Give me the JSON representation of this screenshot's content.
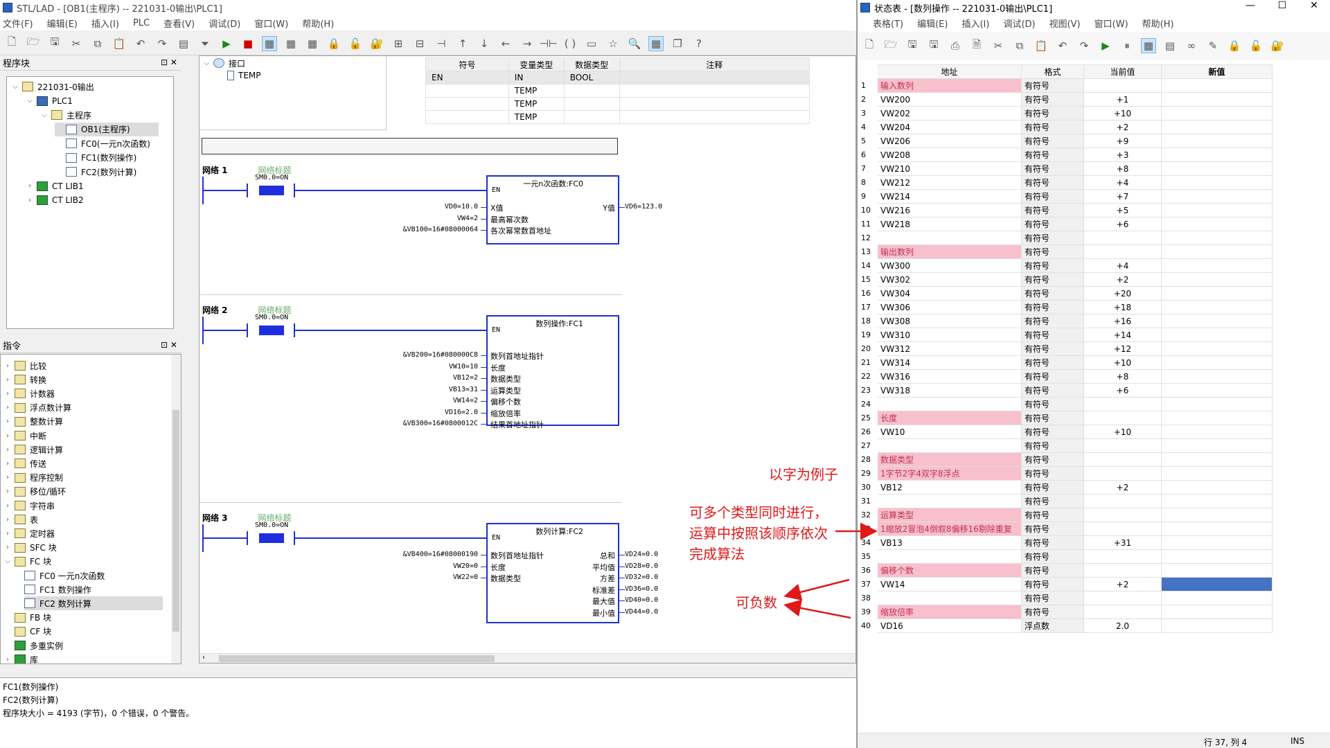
{
  "app": {
    "title": "STL/LAD - [OB1(主程序) -- 221031-0输出\\PLC1]",
    "menus": [
      "文件(F)",
      "编辑(E)",
      "插入(I)",
      "PLC",
      "查看(V)",
      "调试(D)",
      "窗口(W)",
      "帮助(H)"
    ]
  },
  "program_panel": {
    "title": "程序块",
    "items": [
      {
        "label": "221031-0输出",
        "toggle": "⌵",
        "icon": "cat"
      },
      {
        "label": "PLC1",
        "toggle": "⌵",
        "icon": "plc"
      },
      {
        "label": "主程序",
        "toggle": "⌵",
        "icon": "cat"
      },
      {
        "label": "OB1(主程序)",
        "toggle": "",
        "icon": "doc",
        "selected": true
      },
      {
        "label": "FC0(一元n次函数)",
        "toggle": "",
        "icon": "doc"
      },
      {
        "label": "FC1(数列操作)",
        "toggle": "",
        "icon": "doc"
      },
      {
        "label": "FC2(数列计算)",
        "toggle": "",
        "icon": "doc"
      },
      {
        "label": "CT LIB1",
        "toggle": "›",
        "icon": "lib"
      },
      {
        "label": "CT LIB2",
        "toggle": "›",
        "icon": "lib"
      }
    ]
  },
  "instr_panel": {
    "title": "指令",
    "items": [
      {
        "label": "比较",
        "toggle": "›"
      },
      {
        "label": "转换",
        "toggle": "›"
      },
      {
        "label": "计数器",
        "toggle": "›"
      },
      {
        "label": "浮点数计算",
        "toggle": "›"
      },
      {
        "label": "整数计算",
        "toggle": "›"
      },
      {
        "label": "中断",
        "toggle": "›"
      },
      {
        "label": "逻辑计算",
        "toggle": "›"
      },
      {
        "label": "传送",
        "toggle": "›"
      },
      {
        "label": "程序控制",
        "toggle": "›"
      },
      {
        "label": "移位/循环",
        "toggle": "›"
      },
      {
        "label": "字符串",
        "toggle": "›"
      },
      {
        "label": "表",
        "toggle": "›"
      },
      {
        "label": "定时器",
        "toggle": "›"
      },
      {
        "label": "SFC 块",
        "toggle": "›"
      },
      {
        "label": "FC 块",
        "toggle": "⌵"
      },
      {
        "label": "FC0    一元n次函数",
        "toggle": "",
        "icon": "doc",
        "indent": 2
      },
      {
        "label": "FC1    数列操作",
        "toggle": "",
        "icon": "doc",
        "indent": 2
      },
      {
        "label": "FC2    数列计算",
        "toggle": "",
        "icon": "doc",
        "indent": 2,
        "selected": true
      },
      {
        "label": "FB 块",
        "toggle": ""
      },
      {
        "label": "CF 块",
        "toggle": ""
      },
      {
        "label": "多重实例",
        "toggle": "",
        "icon": "lib"
      },
      {
        "label": "库",
        "toggle": "›",
        "icon": "lib"
      }
    ]
  },
  "interface": {
    "root": "接口",
    "child": "TEMP",
    "headers": [
      "符号",
      "变量类型",
      "数据类型",
      "注释"
    ],
    "rows": [
      [
        "EN",
        "IN",
        "BOOL",
        ""
      ],
      [
        "",
        "TEMP",
        "",
        ""
      ],
      [
        "",
        "TEMP",
        "",
        ""
      ],
      [
        "",
        "TEMP",
        "",
        ""
      ]
    ]
  },
  "networks": [
    {
      "label": "网络 1",
      "comment": "网络标题",
      "contact": "SM0.0=ON",
      "block": "一元n次函数:FC0",
      "en": "EN",
      "inputs": [
        {
          "value": "VD0=10.0",
          "name": "X值"
        },
        {
          "value": "VW4=2",
          "name": "最高幂次数"
        },
        {
          "value": "&VB100=16#08000064",
          "name": "各次幂常数首地址"
        }
      ],
      "outputs": [
        {
          "name": "Y值",
          "value": "VD6=123.0"
        }
      ]
    },
    {
      "label": "网络 2",
      "comment": "网络标题",
      "contact": "SM0.0=ON",
      "block": "数列操作:FC1",
      "en": "EN",
      "inputs": [
        {
          "value": "&VB200=16#080000C8",
          "name": "数列首地址指针"
        },
        {
          "value": "VW10=10",
          "name": "长度"
        },
        {
          "value": "VB12=2",
          "name": "数据类型"
        },
        {
          "value": "VB13=31",
          "name": "运算类型"
        },
        {
          "value": "VW14=2",
          "name": "偏移个数"
        },
        {
          "value": "VD16=2.0",
          "name": "缩放倍率"
        },
        {
          "value": "&VB300=16#0800012C",
          "name": "结果首地址指针"
        }
      ],
      "outputs": []
    },
    {
      "label": "网络 3",
      "comment": "网络标题",
      "contact": "SM0.0=ON",
      "block": "数列计算:FC2",
      "en": "EN",
      "inputs": [
        {
          "value": "&VB400=16#08000190",
          "name": "数列首地址指针"
        },
        {
          "value": "VW20=0",
          "name": "长度"
        },
        {
          "value": "VW22=0",
          "name": "数据类型"
        }
      ],
      "outputs": [
        {
          "name": "总和",
          "value": "VD24=0.0"
        },
        {
          "name": "平均值",
          "value": "VD28=0.0"
        },
        {
          "name": "方差",
          "value": "VD32=0.0"
        },
        {
          "name": "标准差",
          "value": "VD36=0.0"
        },
        {
          "name": "最大值",
          "value": "VD40=0.0"
        },
        {
          "name": "最小值",
          "value": "VD44=0.0"
        }
      ]
    }
  ],
  "output_lines": [
    "FC1(数列操作)",
    "FC2(数列计算)",
    "程序块大小 = 4193 (字节)，0 个错误，0 个警告。"
  ],
  "status_window": {
    "title": "状态表 - [数列操作 -- 221031-0输出\\PLC1]",
    "menus": [
      "表格(T)",
      "编辑(E)",
      "插入(I)",
      "调试(D)",
      "视图(V)",
      "窗口(W)",
      "帮助(H)"
    ],
    "headers": [
      "地址",
      "格式",
      "当前值",
      "新值"
    ],
    "rows": [
      {
        "n": "1",
        "addr": "输入数列",
        "fmt": "有符号",
        "cur": "",
        "pink": true
      },
      {
        "n": "2",
        "addr": "VW200",
        "fmt": "有符号",
        "cur": "+1"
      },
      {
        "n": "3",
        "addr": "VW202",
        "fmt": "有符号",
        "cur": "+10"
      },
      {
        "n": "4",
        "addr": "VW204",
        "fmt": "有符号",
        "cur": "+2"
      },
      {
        "n": "5",
        "addr": "VW206",
        "fmt": "有符号",
        "cur": "+9"
      },
      {
        "n": "6",
        "addr": "VW208",
        "fmt": "有符号",
        "cur": "+3"
      },
      {
        "n": "7",
        "addr": "VW210",
        "fmt": "有符号",
        "cur": "+8"
      },
      {
        "n": "8",
        "addr": "VW212",
        "fmt": "有符号",
        "cur": "+4"
      },
      {
        "n": "9",
        "addr": "VW214",
        "fmt": "有符号",
        "cur": "+7"
      },
      {
        "n": "10",
        "addr": "VW216",
        "fmt": "有符号",
        "cur": "+5"
      },
      {
        "n": "11",
        "addr": "VW218",
        "fmt": "有符号",
        "cur": "+6"
      },
      {
        "n": "12",
        "addr": "",
        "fmt": "有符号",
        "cur": ""
      },
      {
        "n": "13",
        "addr": "输出数列",
        "fmt": "有符号",
        "cur": "",
        "pink": true
      },
      {
        "n": "14",
        "addr": "VW300",
        "fmt": "有符号",
        "cur": "+4"
      },
      {
        "n": "15",
        "addr": "VW302",
        "fmt": "有符号",
        "cur": "+2"
      },
      {
        "n": "16",
        "addr": "VW304",
        "fmt": "有符号",
        "cur": "+20"
      },
      {
        "n": "17",
        "addr": "VW306",
        "fmt": "有符号",
        "cur": "+18"
      },
      {
        "n": "18",
        "addr": "VW308",
        "fmt": "有符号",
        "cur": "+16"
      },
      {
        "n": "19",
        "addr": "VW310",
        "fmt": "有符号",
        "cur": "+14"
      },
      {
        "n": "20",
        "addr": "VW312",
        "fmt": "有符号",
        "cur": "+12"
      },
      {
        "n": "21",
        "addr": "VW314",
        "fmt": "有符号",
        "cur": "+10"
      },
      {
        "n": "22",
        "addr": "VW316",
        "fmt": "有符号",
        "cur": "+8"
      },
      {
        "n": "23",
        "addr": "VW318",
        "fmt": "有符号",
        "cur": "+6"
      },
      {
        "n": "24",
        "addr": "",
        "fmt": "有符号",
        "cur": ""
      },
      {
        "n": "25",
        "addr": "长度",
        "fmt": "有符号",
        "cur": "",
        "pink": true
      },
      {
        "n": "26",
        "addr": "VW10",
        "fmt": "有符号",
        "cur": "+10"
      },
      {
        "n": "27",
        "addr": "",
        "fmt": "有符号",
        "cur": ""
      },
      {
        "n": "28",
        "addr": "数据类型",
        "fmt": "有符号",
        "cur": "",
        "pink": true
      },
      {
        "n": "29",
        "addr": "1字节2字4双字8浮点",
        "fmt": "有符号",
        "cur": "",
        "pink": true
      },
      {
        "n": "30",
        "addr": "VB12",
        "fmt": "有符号",
        "cur": "+2"
      },
      {
        "n": "31",
        "addr": "",
        "fmt": "有符号",
        "cur": ""
      },
      {
        "n": "32",
        "addr": "运算类型",
        "fmt": "有符号",
        "cur": "",
        "pink": true
      },
      {
        "n": "33",
        "addr": "1缩放2冒泡4倒叙8偏移16剔除重复",
        "fmt": "有符号",
        "cur": "",
        "pink": true
      },
      {
        "n": "34",
        "addr": "VB13",
        "fmt": "有符号",
        "cur": "+31"
      },
      {
        "n": "35",
        "addr": "",
        "fmt": "有符号",
        "cur": ""
      },
      {
        "n": "36",
        "addr": "偏移个数",
        "fmt": "有符号",
        "cur": "",
        "pink": true
      },
      {
        "n": "37",
        "addr": "VW14",
        "fmt": "有符号",
        "cur": "+2",
        "newsel": true
      },
      {
        "n": "38",
        "addr": "",
        "fmt": "有符号",
        "cur": ""
      },
      {
        "n": "39",
        "addr": "缩放倍率",
        "fmt": "有符号",
        "cur": "",
        "pink": true
      },
      {
        "n": "40",
        "addr": "VD16",
        "fmt": "浮点数",
        "cur": "2.0"
      }
    ],
    "statusbar": {
      "pos": "行 37, 列 4",
      "mode": "INS"
    }
  },
  "annotations": {
    "a1": "以字为例子",
    "a2": [
      "可多个类型同时进行，",
      "运算中按照该顺序依次",
      "完成算法"
    ],
    "a3": "可负数"
  },
  "colors": {
    "wire": "#2030d0",
    "pink": "#f7c0cc",
    "annotation": "#e01818",
    "selected": "#4472c4"
  }
}
